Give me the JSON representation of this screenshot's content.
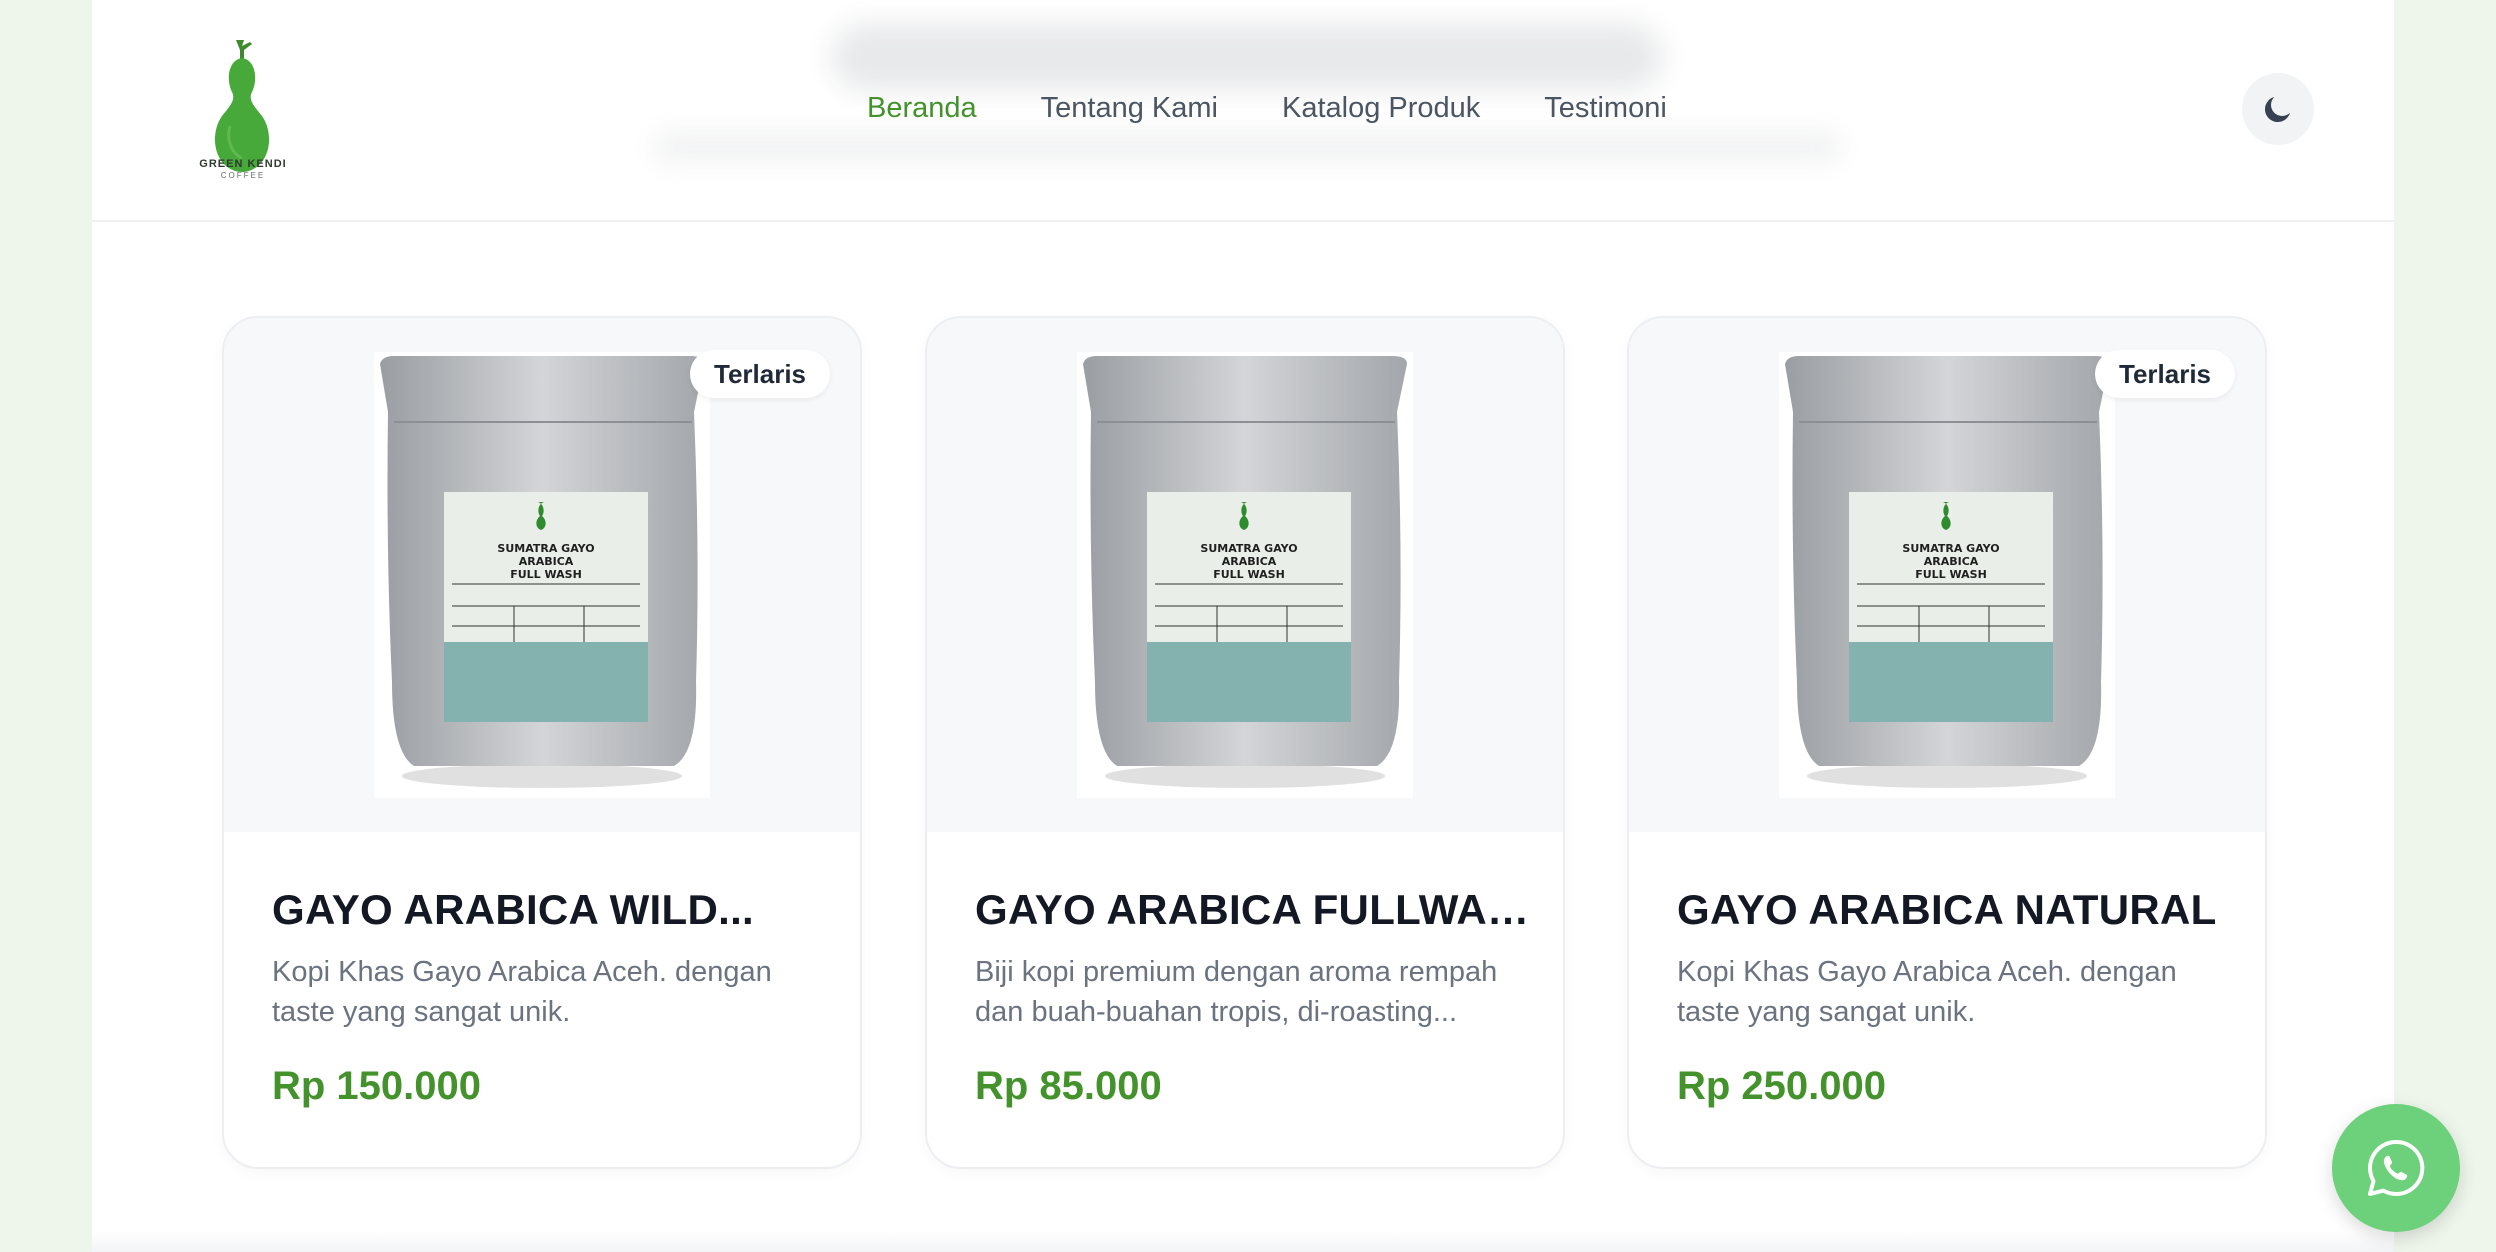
{
  "brand": {
    "name": "GREEN KENDI",
    "tagline": "COFFEE",
    "accent": "#43922c"
  },
  "nav": {
    "items": [
      {
        "label": "Beranda",
        "active": true
      },
      {
        "label": "Tentang Kami",
        "active": false
      },
      {
        "label": "Katalog Produk",
        "active": false
      },
      {
        "label": "Testimoni",
        "active": false
      }
    ],
    "theme_toggle_icon": "moon-icon"
  },
  "products": [
    {
      "badge": "Terlaris",
      "title": "GAYO ARABICA WILD...",
      "description": "Kopi Khas Gayo Arabica Aceh. dengan taste yang sangat unik.",
      "price": "Rp 150.000",
      "image_label": "SUMATRA GAYO ARABICA FULL WASH"
    },
    {
      "badge": "",
      "title": "GAYO ARABICA FULLWASH",
      "description": "Biji kopi premium dengan aroma rempah dan buah-buahan tropis, di-roasting...",
      "price": "Rp 85.000",
      "image_label": "SUMATRA GAYO ARABICA FULL WASH"
    },
    {
      "badge": "Terlaris",
      "title": "GAYO ARABICA NATURAL",
      "description": "Kopi Khas Gayo Arabica Aceh. dengan taste yang sangat unik.",
      "price": "Rp 250.000",
      "image_label": "SUMATRA GAYO ARABICA FULL WASH"
    }
  ],
  "floating": {
    "icon": "whatsapp-icon",
    "color": "#6dd07a"
  }
}
